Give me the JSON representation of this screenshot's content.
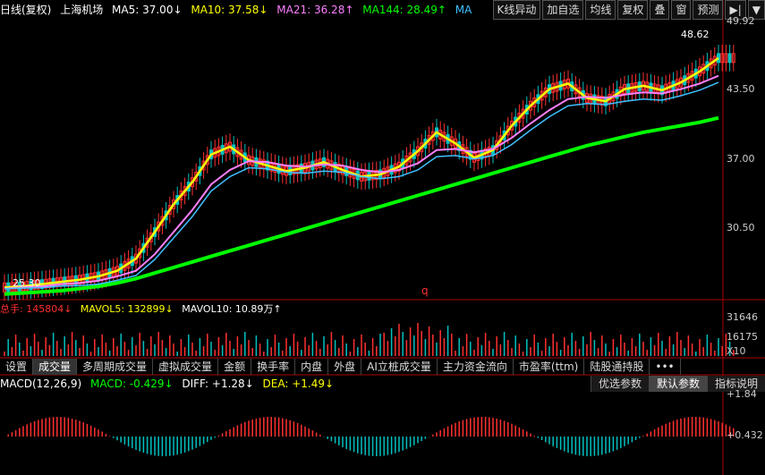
{
  "header": {
    "period": "日线(复权)",
    "stock": "上海机场",
    "ma5": "MA5: 37.00↓",
    "ma10": "MA10: 37.58↓",
    "ma21": "MA21: 36.28↑",
    "ma144": "MA144: 28.49↑",
    "ma_more": "MA"
  },
  "toolbar": [
    "K线异动",
    "加自选",
    "均线",
    "复权",
    "叠",
    "窗",
    "预测",
    "▶|",
    "▼"
  ],
  "price_axis": [
    "49.92",
    "43.50",
    "37.00",
    "30.50"
  ],
  "high_marker": "48.62",
  "low_marker": "25.30",
  "q_marker": "q",
  "volume_header": {
    "total": "总手: 145804↓",
    "mavol5": "MAVOL5: 132899↓",
    "mavol10": "MAVOL10: 10.89万↑"
  },
  "volume_axis": [
    "31646",
    "16175",
    "X10"
  ],
  "tabs": [
    "设置",
    "成交量",
    "多周期成交量",
    "虚拟成交量",
    "金额",
    "换手率",
    "内盘",
    "外盘",
    "AI立桩成交量",
    "主力资金流向",
    "市盈率(ttm)",
    "陆股通持股",
    "•••"
  ],
  "active_tab": "成交量",
  "macd_header": {
    "title": "MACD(12,26,9)",
    "macd": "MACD: -0.429↓",
    "diff": "DIFF: +1.28↓",
    "dea": "DEA: +1.49↓"
  },
  "macd_buttons": [
    "优选参数",
    "默认参数",
    "指标说明"
  ],
  "macd_axis": [
    "+1.84",
    "+0.432"
  ],
  "colors": {
    "ma5": "#ffffff",
    "ma10": "#ffff00",
    "ma21": "#ff80ff",
    "ma144": "#00ff00",
    "ma60": "#40c0ff",
    "up": "#ff3030",
    "down": "#00c0c0"
  },
  "chart_data": {
    "type": "line",
    "title": "上海机场 日线(复权)",
    "ylim": [
      25.3,
      49.92
    ],
    "series": [
      {
        "name": "MA10",
        "values": [
          26.0,
          26.1,
          26.3,
          26.5,
          26.7,
          27.0,
          27.5,
          28.6,
          31.0,
          33.5,
          35.5,
          38.0,
          38.7,
          37.5,
          37.0,
          36.5,
          36.8,
          37.3,
          36.6,
          36.0,
          36.2,
          36.9,
          38.3,
          40.0,
          39.0,
          37.7,
          38.4,
          40.6,
          42.4,
          43.9,
          44.4,
          43.1,
          42.8,
          43.9,
          44.2,
          43.8,
          44.5,
          45.5,
          46.7
        ]
      },
      {
        "name": "MA21",
        "values": [
          25.9,
          26.0,
          26.1,
          26.3,
          26.4,
          26.6,
          27.0,
          27.5,
          29.0,
          31.0,
          33.0,
          35.3,
          36.6,
          37.4,
          37.3,
          37.0,
          36.9,
          37.1,
          37.0,
          36.6,
          36.4,
          36.6,
          37.2,
          38.4,
          38.5,
          38.2,
          38.5,
          39.5,
          40.8,
          42.0,
          43.0,
          43.2,
          43.1,
          43.4,
          43.6,
          43.5,
          43.9,
          44.4,
          45.1
        ]
      },
      {
        "name": "MA144",
        "values": [
          25.4,
          25.5,
          25.6,
          25.7,
          25.9,
          26.1,
          26.4,
          26.8,
          27.3,
          27.8,
          28.3,
          28.8,
          29.3,
          29.8,
          30.3,
          30.8,
          31.3,
          31.8,
          32.3,
          32.8,
          33.3,
          33.8,
          34.3,
          34.8,
          35.3,
          35.8,
          36.3,
          36.8,
          37.3,
          37.8,
          38.3,
          38.8,
          39.2,
          39.6,
          40.0,
          40.3,
          40.6,
          40.9,
          41.3
        ]
      }
    ],
    "volume": {
      "ylim": [
        0,
        31646
      ]
    },
    "macd": {
      "ylim": [
        -0.9,
        1.84
      ]
    }
  }
}
